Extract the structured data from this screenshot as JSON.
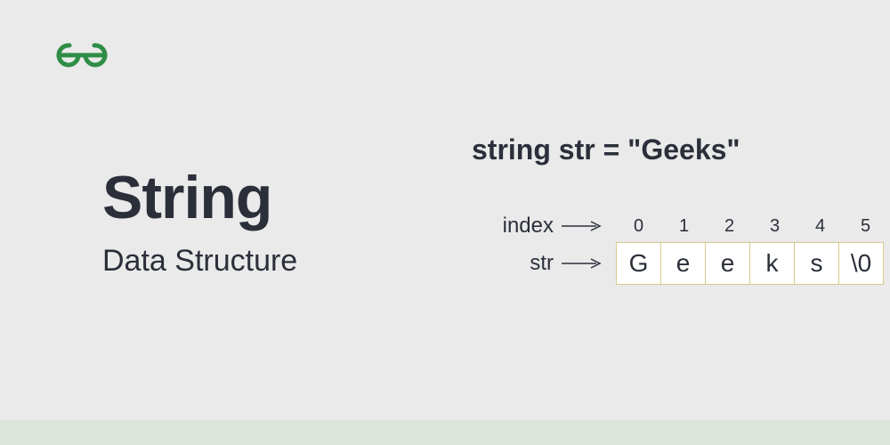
{
  "brand": {
    "color": "#2f8d46"
  },
  "heading": {
    "title": "String",
    "subtitle": "Data Structure"
  },
  "code": {
    "declaration": "string str = \"Geeks\""
  },
  "labels": {
    "index": "index",
    "str": "str"
  },
  "array": {
    "indices": [
      "0",
      "1",
      "2",
      "3",
      "4",
      "5"
    ],
    "chars": [
      "G",
      "e",
      "e",
      "k",
      "s",
      "\\0"
    ]
  }
}
